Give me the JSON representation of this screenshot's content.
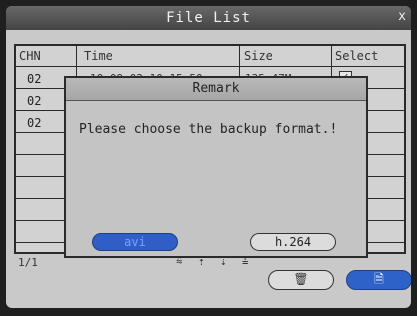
{
  "window": {
    "title": "File List",
    "close_glyph": "x"
  },
  "table": {
    "headers": {
      "chn": "CHN",
      "time": "Time",
      "size": "Size",
      "select": "Select"
    },
    "rows": [
      {
        "chn": "02",
        "time": "10-09-02 10:15:50",
        "size": "135.47M",
        "selected": true,
        "check_glyph": "✓"
      },
      {
        "chn": "02"
      },
      {
        "chn": "02"
      }
    ]
  },
  "pager": {
    "page": "1/1",
    "first_icon": "⩯",
    "prev_icon": "⇡",
    "next_icon": "⇣",
    "last_icon": "⩮"
  },
  "footer": {
    "delete_icon": "🗑",
    "backup_icon": "🗎"
  },
  "dialog": {
    "title": "Remark",
    "message": "Please choose the backup format.!",
    "option_avi": "avi",
    "option_h264": "h.264"
  }
}
